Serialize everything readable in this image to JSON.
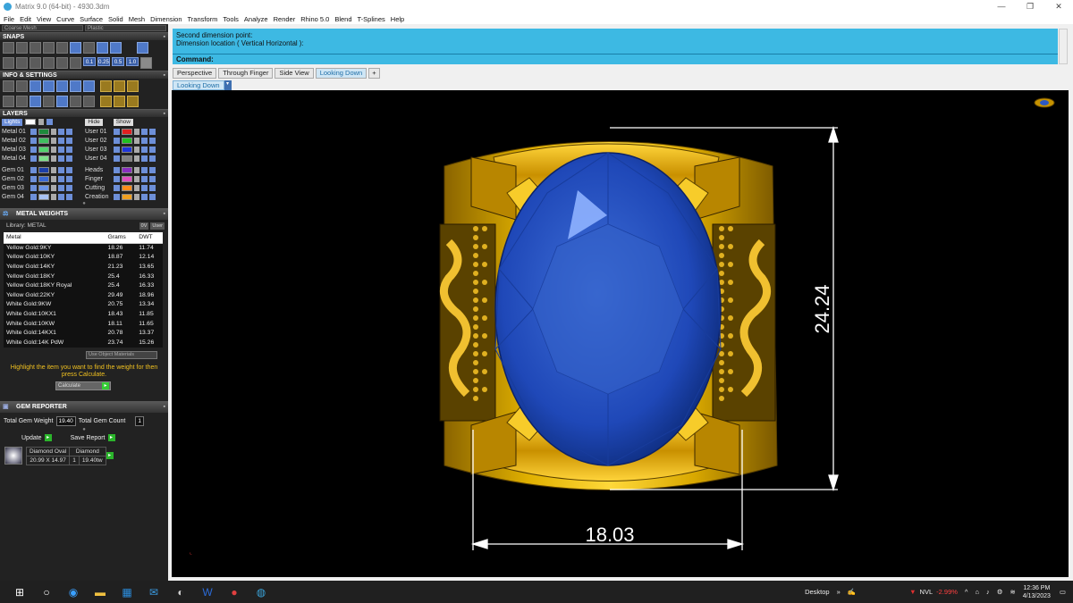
{
  "window": {
    "title": "Matrix 9.0 (64-bit) - 4930.3dm",
    "minimize": "—",
    "restore": "❐",
    "close": "✕"
  },
  "menu": [
    "File",
    "Edit",
    "View",
    "Curve",
    "Surface",
    "Solid",
    "Mesh",
    "Dimension",
    "Transform",
    "Tools",
    "Analyze",
    "Render",
    "Rhino 5.0",
    "Blend",
    "T-Splines",
    "Help"
  ],
  "left": {
    "mesh_dropdown": "Coarse Mesh",
    "material_dropdown": "Plastic",
    "snaps_title": "SNAPS",
    "snap_values": [
      "0.1",
      "0.25",
      "0.5",
      "1.0"
    ],
    "info_title": "INFO & SETTINGS",
    "layers_title": "LAYERS",
    "lights_label": "Lights",
    "hide_label": "Hide",
    "show_label": "Show",
    "layers_left": [
      {
        "name": "Metal 01",
        "color": "#1e8a3c"
      },
      {
        "name": "Metal 02",
        "color": "#3fbf5f"
      },
      {
        "name": "Metal 03",
        "color": "#52d46d"
      },
      {
        "name": "Metal 04",
        "color": "#7ee08a"
      },
      {
        "name": "Gem 01",
        "color": "#1c3fa8"
      },
      {
        "name": "Gem 02",
        "color": "#3a6ad6"
      },
      {
        "name": "Gem 03",
        "color": "#6d95e8"
      },
      {
        "name": "Gem 04",
        "color": "#a9c2f2"
      }
    ],
    "layers_right": [
      {
        "name": "User 01",
        "color": "#e02020"
      },
      {
        "name": "User 02",
        "color": "#20c020"
      },
      {
        "name": "User 03",
        "color": "#1f35d9"
      },
      {
        "name": "User 04",
        "color": "#808080"
      },
      {
        "name": "Heads",
        "color": "#8a2fbf"
      },
      {
        "name": "Finger",
        "color": "#e04fbf"
      },
      {
        "name": "Cutting",
        "color": "#ff8c1a"
      },
      {
        "name": "Creation",
        "color": "#f0a020"
      }
    ],
    "metal_weights_title": "METAL WEIGHTS",
    "library_label": "Library: METAL",
    "library_btn1": "0V",
    "library_btn2": "User",
    "mw_headers": [
      "Metal",
      "Grams",
      "DWT"
    ],
    "mw_rows": [
      [
        "Yellow Gold:9KY",
        "18.26",
        "11.74"
      ],
      [
        "Yellow Gold:10KY",
        "18.87",
        "12.14"
      ],
      [
        "Yellow Gold:14KY",
        "21.23",
        "13.65"
      ],
      [
        "Yellow Gold:18KY",
        "25.4",
        "16.33"
      ],
      [
        "Yellow Gold:18KY Royal",
        "25.4",
        "16.33"
      ],
      [
        "Yellow Gold:22KY",
        "29.49",
        "18.96"
      ],
      [
        "White Gold:9KW",
        "20.75",
        "13.34"
      ],
      [
        "White Gold:10KX1",
        "18.43",
        "11.85"
      ],
      [
        "White Gold:10KW",
        "18.11",
        "11.65"
      ],
      [
        "White Gold:14KX1",
        "20.78",
        "13.37"
      ],
      [
        "White Gold:14K PdW",
        "23.74",
        "15.26"
      ]
    ],
    "use_object_materials": "Use Object Materials",
    "highlight_msg": "Highlight the item you want to find the weight for then press Calculate.",
    "calculate": "Calculate",
    "gem_reporter_title": "GEM REPORTER",
    "total_gem_weight_label": "Total Gem Weight",
    "total_gem_weight": "19.40",
    "total_gem_count_label": "Total Gem Count",
    "total_gem_count": "1",
    "update_label": "Update",
    "save_report_label": "Save Report",
    "gem_shape": "Diamond Oval",
    "gem_size": "20.99 X 14.97",
    "gem_type": "Diamond",
    "gem_qty": "1",
    "gem_weight": "19.40tw"
  },
  "command": {
    "line1": "Second dimension point:",
    "line2": "Dimension location ( Vertical  Horizontal ):",
    "prompt": "Command:"
  },
  "tabs": [
    "Perspective",
    "Through Finger",
    "Side View",
    "Looking Down",
    "+"
  ],
  "active_tab": "Looking Down",
  "viewport_label": "Looking Down",
  "dimensions": {
    "vertical": "24.24",
    "horizontal": "18.03"
  },
  "taskbar": {
    "desktop": "Desktop",
    "ticker": "NVL",
    "ticker_change": "-2.99%",
    "time": "12:36 PM",
    "date": "4/13/2023"
  }
}
